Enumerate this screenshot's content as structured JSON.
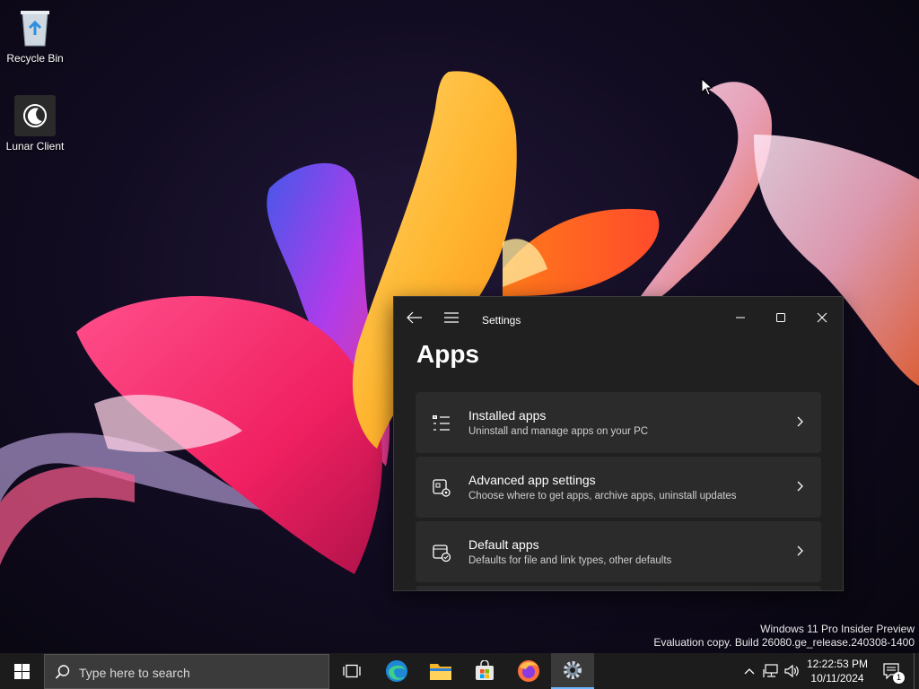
{
  "desktop": {
    "icons": [
      {
        "label": "Recycle Bin",
        "icon": "recycle-bin-icon"
      },
      {
        "label": "Lunar Client",
        "icon": "lunar-client-icon"
      }
    ],
    "watermark": {
      "line1": "Windows 11 Pro Insider Preview",
      "line2": "Evaluation copy. Build 26080.ge_release.240308-1400"
    }
  },
  "settings": {
    "window_title": "Settings",
    "page_title": "Apps",
    "items": [
      {
        "title": "Installed apps",
        "subtitle": "Uninstall and manage apps on your PC",
        "icon": "installed-apps-icon"
      },
      {
        "title": "Advanced app settings",
        "subtitle": "Choose where to get apps, archive apps, uninstall updates",
        "icon": "advanced-app-settings-icon"
      },
      {
        "title": "Default apps",
        "subtitle": "Defaults for file and link types, other defaults",
        "icon": "default-apps-icon"
      }
    ]
  },
  "taskbar": {
    "search_placeholder": "Type here to search",
    "apps": [
      "task-view",
      "edge",
      "file-explorer",
      "microsoft-store",
      "firefox",
      "settings"
    ],
    "active_app": "settings",
    "time": "12:22:53 PM",
    "date": "10/11/2024",
    "notification_count": "1",
    "accent": "#6cb6ff"
  }
}
